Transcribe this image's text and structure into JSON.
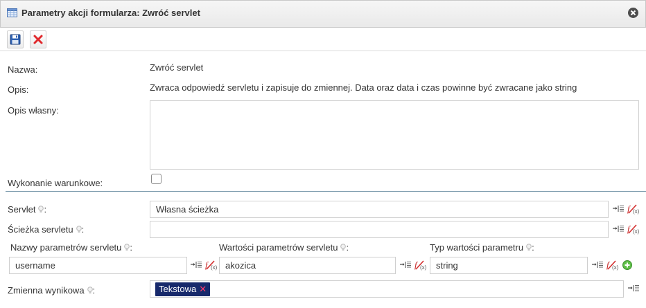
{
  "window": {
    "title": "Parametry akcji formularza: Zwróć servlet"
  },
  "toolbar": {
    "save_icon": "save-icon",
    "cancel_icon": "cancel-icon"
  },
  "form": {
    "name_label": "Nazwa:",
    "name_value": "Zwróć servlet",
    "description_label": "Opis:",
    "description_value": "Zwraca odpowiedź servletu i zapisuje do zmiennej. Data oraz data i czas powinne być zwracane jako string",
    "custom_description_label": "Opis własny:",
    "custom_description_value": "",
    "conditional_label": "Wykonanie warunkowe:",
    "conditional_checked": false,
    "servlet_label": "Servlet",
    "servlet_value": "Własna ścieżka",
    "servlet_path_label": "Ścieżka servletu",
    "servlet_path_value": "",
    "param_names_label": "Nazwy parametrów servletu",
    "param_names_value": "username",
    "param_values_label": "Wartości parametrów servletu",
    "param_values_value": "akozica",
    "param_types_label": "Typ wartości parametru",
    "param_types_value": "string",
    "result_var_label": "Zmienna wynikowa",
    "result_var_tag": "Tekstowa",
    "colon": ":"
  },
  "colors": {
    "accent_navy": "#17296b",
    "separator": "#7a9aac",
    "add_green": "#5fbf48",
    "delete_red": "#e0292d"
  }
}
